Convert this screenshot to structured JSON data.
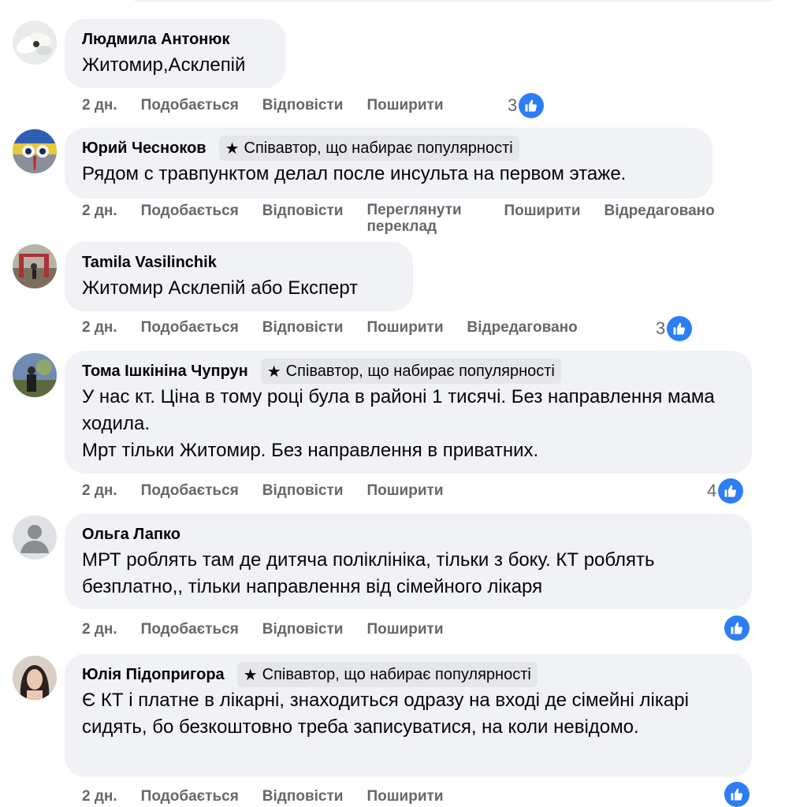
{
  "comments": [
    {
      "author": "Людмила Антонюк",
      "badge": "",
      "text": "Житомир,Асклепій",
      "time": "2 дн.",
      "like": "Подобається",
      "reply": "Відповісти",
      "translate": "",
      "share": "Поширити",
      "edited": "",
      "reactions": "3"
    },
    {
      "author": "Юрий Чесноков",
      "badge": "Співавтор, що набирає популярності",
      "text": "Рядом с травпунктом делал после инсульта на первом этаже.",
      "time": "2 дн.",
      "like": "Подобається",
      "reply": "Відповісти",
      "translate": "Переглянути переклад",
      "share": "Поширити",
      "edited": "Відредаговано",
      "reactions": ""
    },
    {
      "author": "Tamila Vasilinchik",
      "badge": "",
      "text": "Житомир Асклепій або Експерт",
      "time": "2 дн.",
      "like": "Подобається",
      "reply": "Відповісти",
      "translate": "",
      "share": "Поширити",
      "edited": "Відредаговано",
      "reactions": "3"
    },
    {
      "author": "Тома Ішкініна Чупрун",
      "badge": "Співавтор, що набирає популярності",
      "text": "У нас кт. Ціна в тому році була в районі 1 тисячі. Без направлення мама ходила.\nМрт тільки Житомир. Без направлення в приватних.",
      "time": "2 дн.",
      "like": "Подобається",
      "reply": "Відповісти",
      "translate": "",
      "share": "Поширити",
      "edited": "",
      "reactions": "4"
    },
    {
      "author": "Ольга Лапко",
      "badge": "",
      "text": "МРТ роблять там де дитяча поліклініка, тільки з боку. КТ роблять безплатно,, тільки направлення від сімейного лікаря",
      "time": "2 дн.",
      "like": "Подобається",
      "reply": "Відповісти",
      "translate": "",
      "share": "Поширити",
      "edited": "",
      "reactions": ""
    },
    {
      "author": "Юлія Підопригора",
      "badge": "Співавтор, що набирає популярності",
      "text": "Є КТ і платне в лікарні, знаходиться одразу на вході де сімейні лікарі сидять, бо безкоштовно треба записуватися, на коли невідомо.",
      "time": "2 дн.",
      "like": "Подобається",
      "reply": "Відповісти",
      "translate": "",
      "share": "Поширити",
      "edited": "",
      "reactions": ""
    }
  ],
  "colors": {
    "bubble": "#f0f2f5",
    "badge": "#e4e6eb",
    "meta": "#65676b",
    "like_blue": "#2d7df6"
  },
  "icons": {
    "badge": "star-icon",
    "reaction": "like-thumb-icon"
  }
}
